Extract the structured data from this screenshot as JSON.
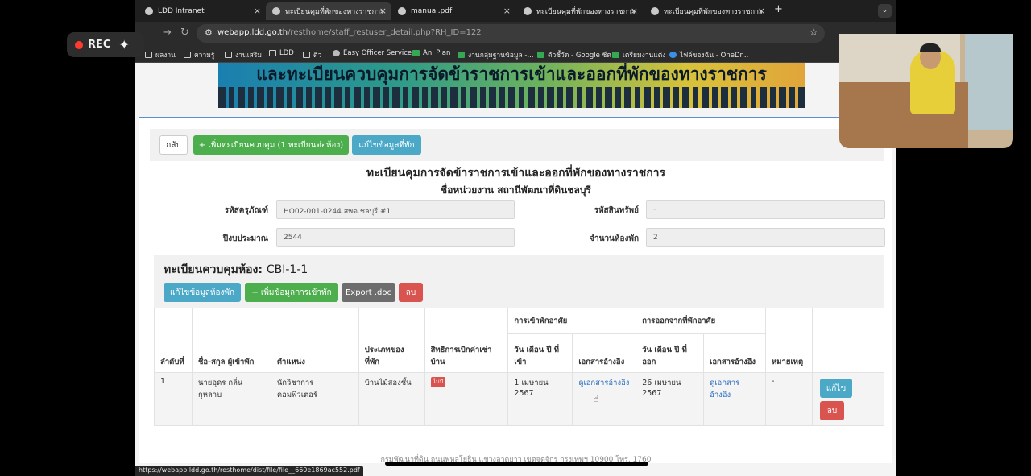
{
  "tabs": [
    {
      "label": "LDD Intranet"
    },
    {
      "label": "ทะเบียนคุมที่พักของทางราชการ"
    },
    {
      "label": "manual.pdf"
    },
    {
      "label": "ทะเบียนคุมที่พักของทางราชการ"
    },
    {
      "label": "ทะเบียนคุมที่พักของทางราชการ"
    }
  ],
  "address": {
    "host": "webapp.ldd.go.th",
    "path": "/resthome/staff_restuser_detail.php?RH_ID=122"
  },
  "bookmarks": [
    {
      "label": "ผลงาน",
      "icon": "folder-icon"
    },
    {
      "label": "ความรู้",
      "icon": "folder-icon"
    },
    {
      "label": "งานเสริม",
      "icon": "folder-icon"
    },
    {
      "label": "LDD",
      "icon": "folder-icon"
    },
    {
      "label": "ติว",
      "icon": "folder-icon"
    },
    {
      "label": "Easy Officer Service",
      "icon": "site-icon"
    },
    {
      "label": "Ani Plan",
      "icon": "sheets-icon"
    },
    {
      "label": "งานกลุ่มฐานข้อมูล -...",
      "icon": "sheets-icon"
    },
    {
      "label": "ตัวชี้วัด - Google ชีต",
      "icon": "sheets-icon"
    },
    {
      "label": "เตรียมงานแต่ง",
      "icon": "sheets-icon"
    },
    {
      "label": "ไฟล์ของฉัน - OneDr...",
      "icon": "onedrive-icon"
    }
  ],
  "recorder": {
    "label": "REC"
  },
  "page": {
    "banner_text": "และทะเบียนควบคุมการจัดข้าราชการเข้าและออกที่พักของทางราชการ",
    "buttons": {
      "back": "กลับ",
      "add_register": "+ เพิ่มทะเบียนควบคุม (1 ทะเบียนต่อห้อง)",
      "edit_residence": "แก้ไขข้อมูลที่พัก"
    },
    "title": "ทะเบียนคุมการจัดข้าราชการเข้าและออกที่พักของทางราชการ",
    "subtitle": "ชื่อหน่วยงาน สถานีพัฒนาที่ดินชลบุรี",
    "fields": {
      "equipment_code_label": "รหัสครุภัณฑ์",
      "equipment_code_value": "HO02-001-0244 สพด.ชลบุรี #1",
      "asset_code_label": "รหัสสินทรัพย์",
      "asset_code_value": "-",
      "fiscal_year_label": "ปีงบประมาณ",
      "fiscal_year_value": "2544",
      "rooms_label": "จำนวนห้องพัก",
      "rooms_value": "2"
    },
    "section": {
      "title": "ทะเบียนควบคุมห้อง: ",
      "room_code": "CBI-1-1",
      "buttons": {
        "edit_room": "แก้ไขข้อมูลห้องพัก",
        "add_checkin": "+ เพิ่มข้อมูลการเข้าพัก",
        "export": "Export .doc",
        "delete": "ลบ"
      }
    },
    "table": {
      "group_in": "การเข้าพักอาศัย",
      "group_out": "การออกจากที่พักอาศัย",
      "headers": {
        "no": "ลำดับที่",
        "name": "ชื่อ-สกุล ผู้เข้าพัก",
        "position": "ตำแหน่ง",
        "type": "ประเภทของที่พัก",
        "rights": "สิทธิการเบิกค่าเช่าบ้าน",
        "in_date": "วัน เดือน ปี ที่เข้า",
        "in_doc": "เอกสารอ้างอิง",
        "out_date": "วัน เดือน ปี ที่ออก",
        "out_doc": "เอกสารอ้างอิง",
        "remark": "หมายเหตุ"
      },
      "rows": [
        {
          "no": "1",
          "name": "นายอุดร กลิ่นกุหลาบ",
          "position": "นักวิชาการคอมพิวเตอร์",
          "type": "บ้านไม้สองชั้น",
          "rights": "ไม่มี",
          "in_date": "1 เมษายน 2567",
          "in_doc": "ดูเอกสารอ้างอิง",
          "out_date": "26 เมษายน 2567",
          "out_doc": "ดูเอกสารอ้างอิง",
          "remark": "-",
          "edit": "แก้ไข",
          "delete": "ลบ"
        }
      ]
    },
    "footer": "กรมพัฒนาที่ดิน ถนนพหลโยธิน แขวงลาดยาว เขตจตุจักร กรุงเทพฯ 10900 โทร. 1760"
  },
  "status_url": "https://webapp.ldd.go.th/resthome/dist/file/file__660e1869ac552.pdf"
}
